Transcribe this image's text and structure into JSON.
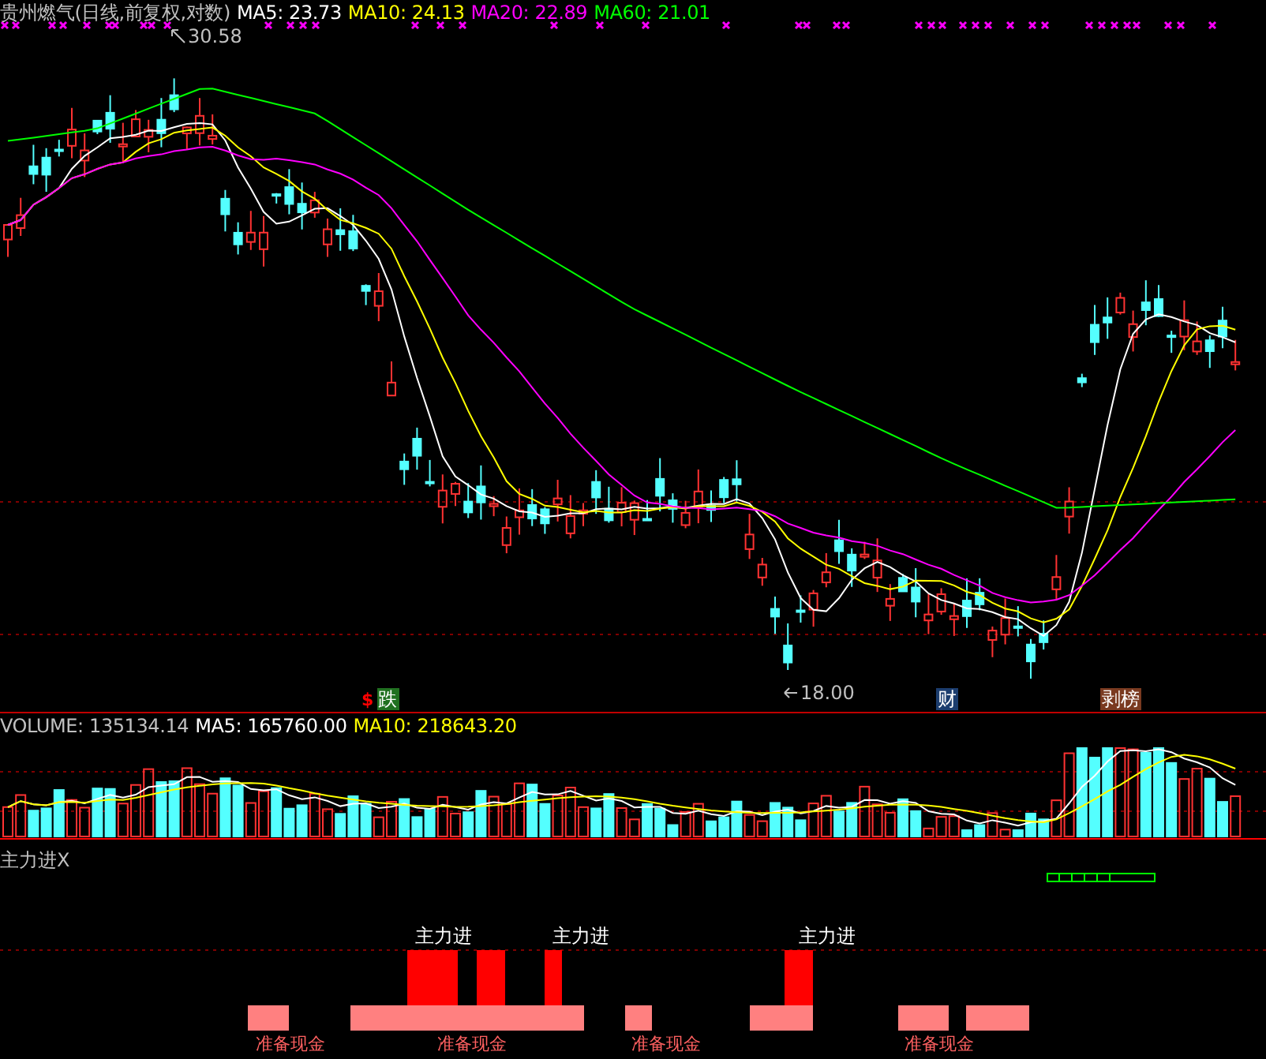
{
  "chart": {
    "title": "贵州燃气(日线,前复权,对数)",
    "ma": [
      {
        "label": "MA5: 23.73",
        "color": "#ffffff"
      },
      {
        "label": "MA10: 24.13",
        "color": "#ffff00"
      },
      {
        "label": "MA20: 22.89",
        "color": "#ff00ff"
      },
      {
        "label": "MA60: 21.01",
        "color": "#00ff00"
      }
    ],
    "high_label": "30.58",
    "low_label": "18.00",
    "markers": [
      {
        "kind": "down",
        "icon": "$",
        "text": "跌"
      },
      {
        "kind": "finance",
        "text": "财"
      },
      {
        "kind": "rank",
        "text": "剥榜"
      }
    ]
  },
  "volume": {
    "title": "VOLUME: 135134.14",
    "ma": [
      {
        "label": "MA5: 165760.00",
        "color": "#ffffff"
      },
      {
        "label": "MA10: 218643.20",
        "color": "#ffff00"
      }
    ]
  },
  "indicator": {
    "title": "主力进X",
    "signals": [
      {
        "text": "主力进"
      },
      {
        "text": "主力进"
      },
      {
        "text": "主力进"
      }
    ],
    "cash": [
      {
        "text": "准备现金"
      },
      {
        "text": "准备现金"
      },
      {
        "text": "准备现金"
      },
      {
        "text": "准备现金"
      }
    ]
  }
}
